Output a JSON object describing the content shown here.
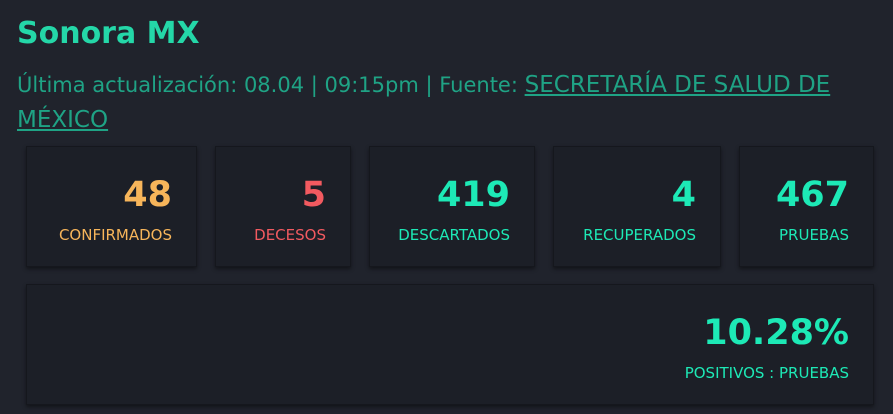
{
  "header": {
    "title": "Sonora MX",
    "update_prefix": "Última actualización: 08.04 | 09:15pm | Fuente: ",
    "source_link": "SECRETARÍA DE SALUD DE MÉXICO"
  },
  "stats": [
    {
      "value": "48",
      "label": "CONFIRMADOS",
      "color": "#f7b55a"
    },
    {
      "value": "5",
      "label": "DECESOS",
      "color": "#f25a60"
    },
    {
      "value": "419",
      "label": "DESCARTADOS",
      "color": "#1de9b6"
    },
    {
      "value": "4",
      "label": "RECUPERADOS",
      "color": "#1de9b6"
    },
    {
      "value": "467",
      "label": "PRUEBAS",
      "color": "#1de9b6"
    }
  ],
  "positivity": {
    "value": "10.28%",
    "label": "POSITIVOS : PRUEBAS",
    "color": "#1de9b6"
  },
  "colors": {
    "background": "#20232c",
    "card": "#1c1f27",
    "title": "#24d7a8",
    "subtitle": "#1fa385"
  }
}
